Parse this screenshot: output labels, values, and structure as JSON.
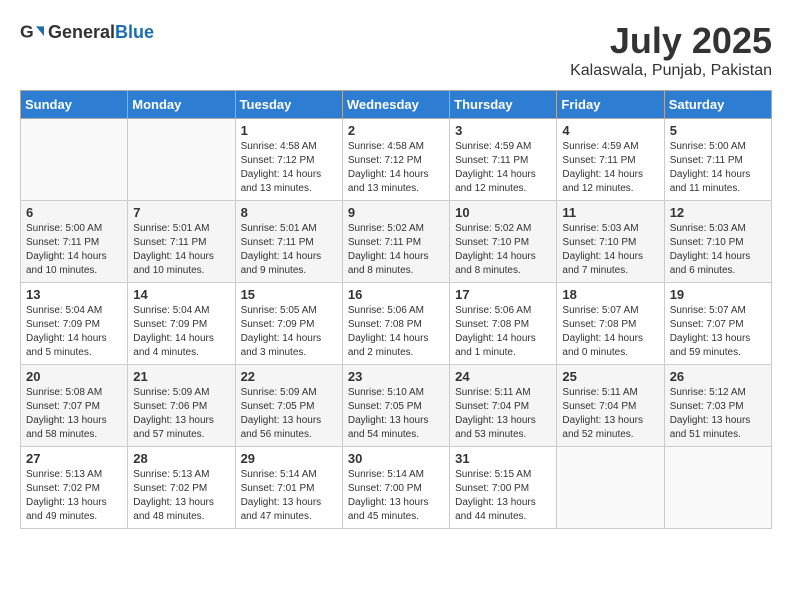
{
  "header": {
    "logo_general": "General",
    "logo_blue": "Blue",
    "month_title": "July 2025",
    "location": "Kalaswala, Punjab, Pakistan"
  },
  "days_of_week": [
    "Sunday",
    "Monday",
    "Tuesday",
    "Wednesday",
    "Thursday",
    "Friday",
    "Saturday"
  ],
  "weeks": [
    [
      {
        "day": "",
        "info": ""
      },
      {
        "day": "",
        "info": ""
      },
      {
        "day": "1",
        "info": "Sunrise: 4:58 AM\nSunset: 7:12 PM\nDaylight: 14 hours and 13 minutes."
      },
      {
        "day": "2",
        "info": "Sunrise: 4:58 AM\nSunset: 7:12 PM\nDaylight: 14 hours and 13 minutes."
      },
      {
        "day": "3",
        "info": "Sunrise: 4:59 AM\nSunset: 7:11 PM\nDaylight: 14 hours and 12 minutes."
      },
      {
        "day": "4",
        "info": "Sunrise: 4:59 AM\nSunset: 7:11 PM\nDaylight: 14 hours and 12 minutes."
      },
      {
        "day": "5",
        "info": "Sunrise: 5:00 AM\nSunset: 7:11 PM\nDaylight: 14 hours and 11 minutes."
      }
    ],
    [
      {
        "day": "6",
        "info": "Sunrise: 5:00 AM\nSunset: 7:11 PM\nDaylight: 14 hours and 10 minutes."
      },
      {
        "day": "7",
        "info": "Sunrise: 5:01 AM\nSunset: 7:11 PM\nDaylight: 14 hours and 10 minutes."
      },
      {
        "day": "8",
        "info": "Sunrise: 5:01 AM\nSunset: 7:11 PM\nDaylight: 14 hours and 9 minutes."
      },
      {
        "day": "9",
        "info": "Sunrise: 5:02 AM\nSunset: 7:11 PM\nDaylight: 14 hours and 8 minutes."
      },
      {
        "day": "10",
        "info": "Sunrise: 5:02 AM\nSunset: 7:10 PM\nDaylight: 14 hours and 8 minutes."
      },
      {
        "day": "11",
        "info": "Sunrise: 5:03 AM\nSunset: 7:10 PM\nDaylight: 14 hours and 7 minutes."
      },
      {
        "day": "12",
        "info": "Sunrise: 5:03 AM\nSunset: 7:10 PM\nDaylight: 14 hours and 6 minutes."
      }
    ],
    [
      {
        "day": "13",
        "info": "Sunrise: 5:04 AM\nSunset: 7:09 PM\nDaylight: 14 hours and 5 minutes."
      },
      {
        "day": "14",
        "info": "Sunrise: 5:04 AM\nSunset: 7:09 PM\nDaylight: 14 hours and 4 minutes."
      },
      {
        "day": "15",
        "info": "Sunrise: 5:05 AM\nSunset: 7:09 PM\nDaylight: 14 hours and 3 minutes."
      },
      {
        "day": "16",
        "info": "Sunrise: 5:06 AM\nSunset: 7:08 PM\nDaylight: 14 hours and 2 minutes."
      },
      {
        "day": "17",
        "info": "Sunrise: 5:06 AM\nSunset: 7:08 PM\nDaylight: 14 hours and 1 minute."
      },
      {
        "day": "18",
        "info": "Sunrise: 5:07 AM\nSunset: 7:08 PM\nDaylight: 14 hours and 0 minutes."
      },
      {
        "day": "19",
        "info": "Sunrise: 5:07 AM\nSunset: 7:07 PM\nDaylight: 13 hours and 59 minutes."
      }
    ],
    [
      {
        "day": "20",
        "info": "Sunrise: 5:08 AM\nSunset: 7:07 PM\nDaylight: 13 hours and 58 minutes."
      },
      {
        "day": "21",
        "info": "Sunrise: 5:09 AM\nSunset: 7:06 PM\nDaylight: 13 hours and 57 minutes."
      },
      {
        "day": "22",
        "info": "Sunrise: 5:09 AM\nSunset: 7:05 PM\nDaylight: 13 hours and 56 minutes."
      },
      {
        "day": "23",
        "info": "Sunrise: 5:10 AM\nSunset: 7:05 PM\nDaylight: 13 hours and 54 minutes."
      },
      {
        "day": "24",
        "info": "Sunrise: 5:11 AM\nSunset: 7:04 PM\nDaylight: 13 hours and 53 minutes."
      },
      {
        "day": "25",
        "info": "Sunrise: 5:11 AM\nSunset: 7:04 PM\nDaylight: 13 hours and 52 minutes."
      },
      {
        "day": "26",
        "info": "Sunrise: 5:12 AM\nSunset: 7:03 PM\nDaylight: 13 hours and 51 minutes."
      }
    ],
    [
      {
        "day": "27",
        "info": "Sunrise: 5:13 AM\nSunset: 7:02 PM\nDaylight: 13 hours and 49 minutes."
      },
      {
        "day": "28",
        "info": "Sunrise: 5:13 AM\nSunset: 7:02 PM\nDaylight: 13 hours and 48 minutes."
      },
      {
        "day": "29",
        "info": "Sunrise: 5:14 AM\nSunset: 7:01 PM\nDaylight: 13 hours and 47 minutes."
      },
      {
        "day": "30",
        "info": "Sunrise: 5:14 AM\nSunset: 7:00 PM\nDaylight: 13 hours and 45 minutes."
      },
      {
        "day": "31",
        "info": "Sunrise: 5:15 AM\nSunset: 7:00 PM\nDaylight: 13 hours and 44 minutes."
      },
      {
        "day": "",
        "info": ""
      },
      {
        "day": "",
        "info": ""
      }
    ]
  ]
}
